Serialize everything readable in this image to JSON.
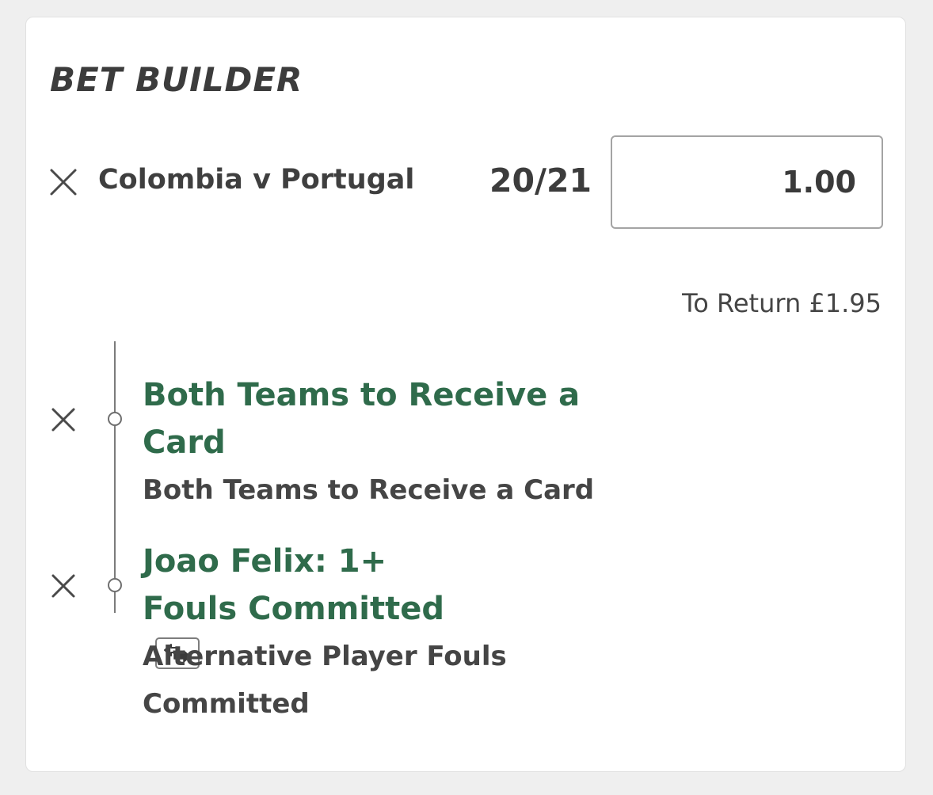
{
  "bet_builder": {
    "title": "BET BUILDER",
    "match": "Colombia v Portugal",
    "odds": "20/21",
    "stake": "1.00",
    "to_return": "To Return £1.95",
    "selections": [
      {
        "name": "Both Teams to Receive a Card",
        "market": "Both Teams to Receive a Card"
      },
      {
        "name": "Joao Felix: 1+ Fouls Committed",
        "market": "Alternative Player Fouls Committed",
        "badge_icon": "swap-icon"
      }
    ]
  },
  "colors": {
    "background": "#efefef",
    "card": "#ffffff",
    "selection_green": "#2f6b4b",
    "text_dark": "#3f3f3f",
    "input_border": "#a4a4a4"
  },
  "icons": {
    "remove": "close-icon",
    "timeline": "timeline-node-icon",
    "swap": "swap-icon"
  }
}
